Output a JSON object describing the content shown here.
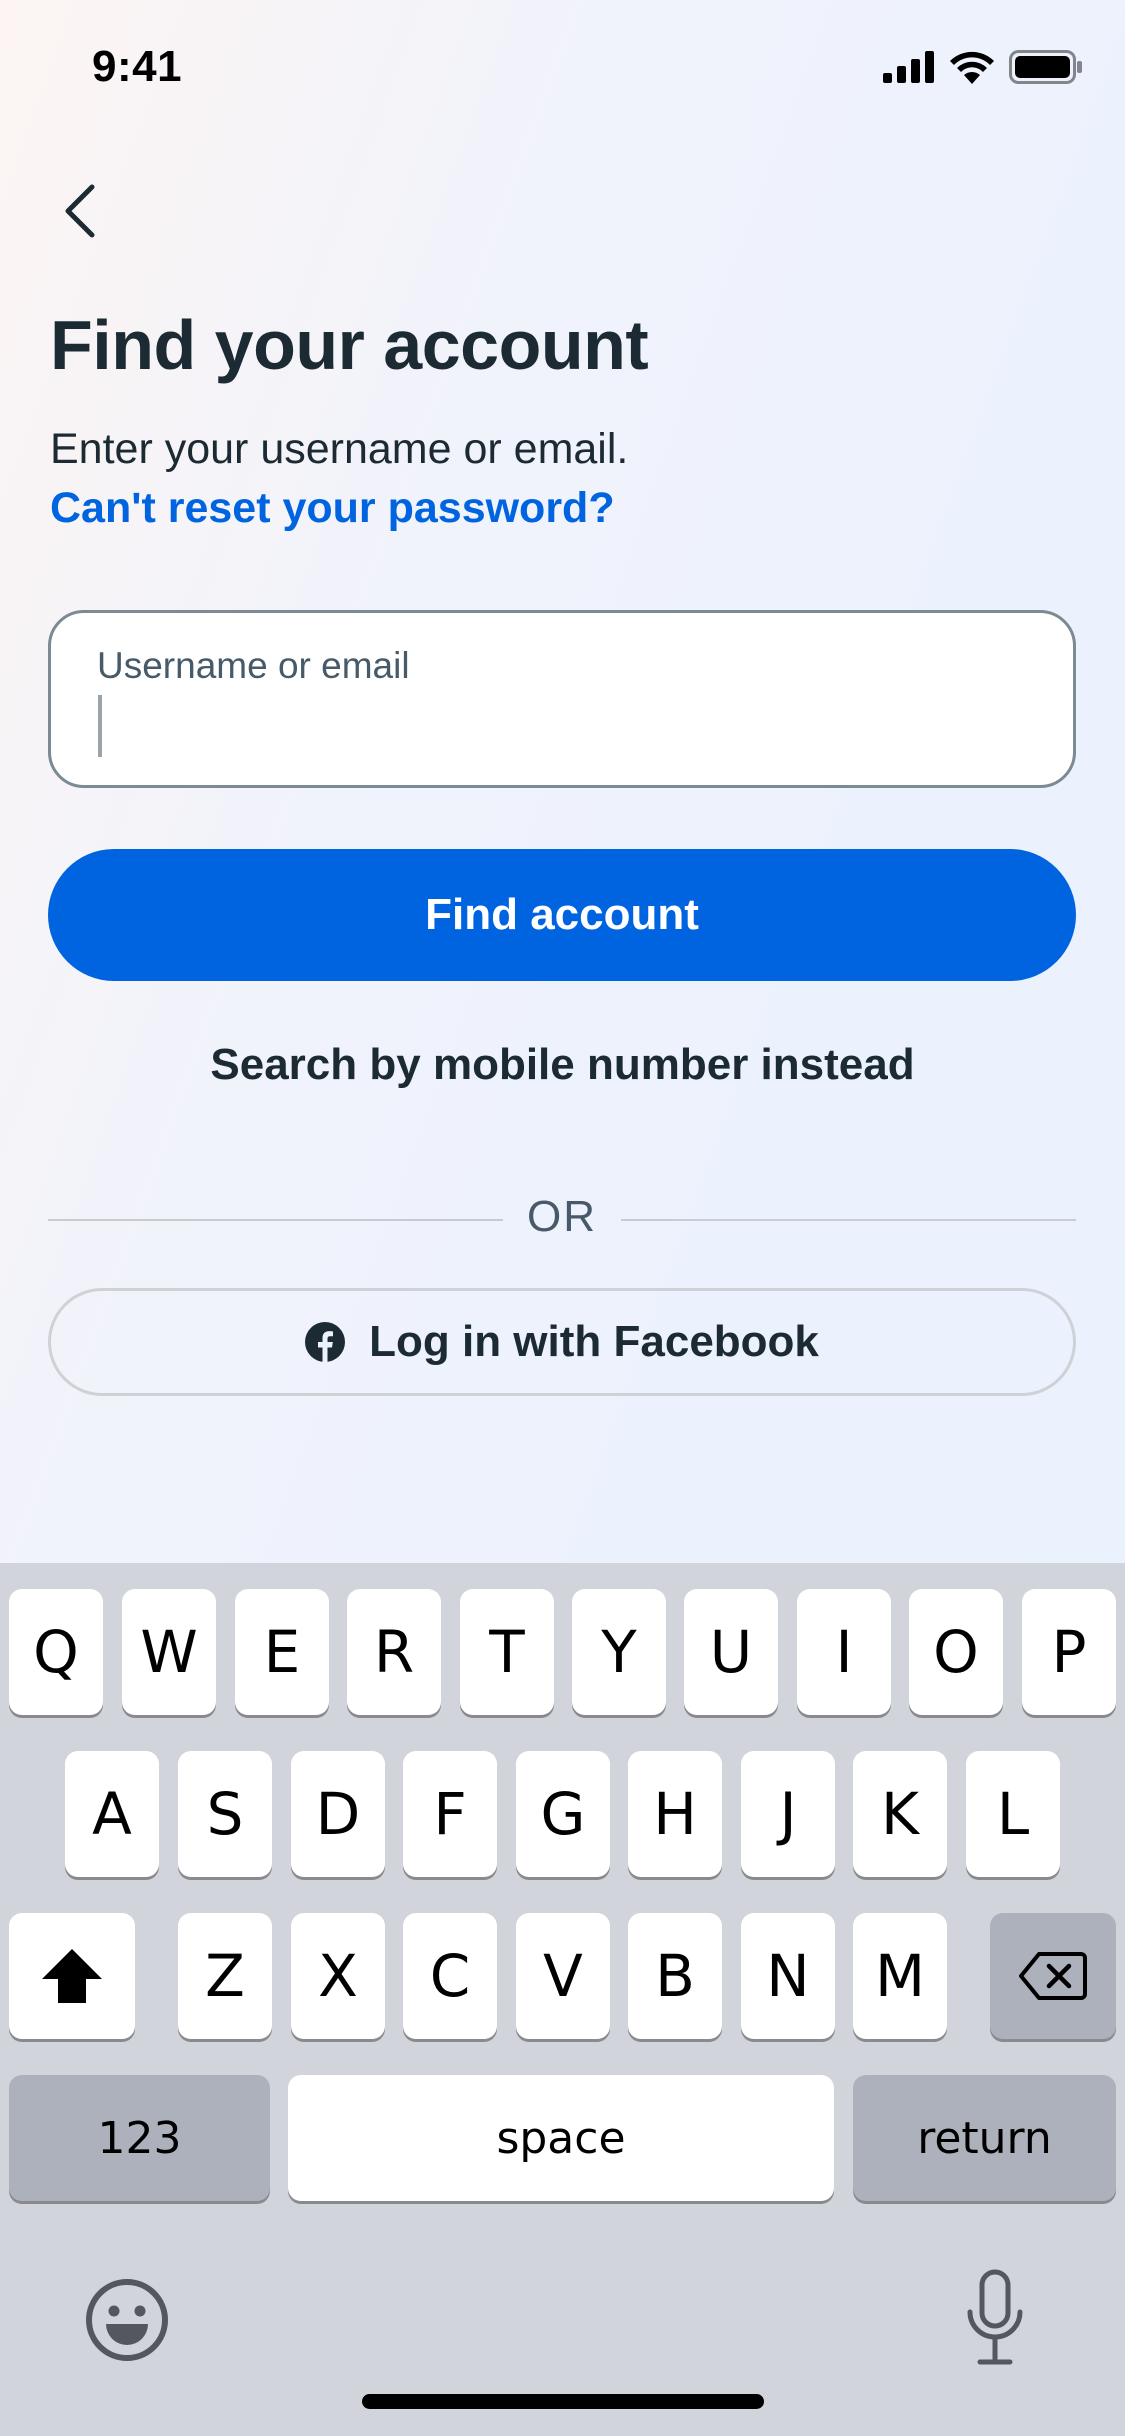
{
  "status_bar": {
    "time": "9:41"
  },
  "header": {
    "title": "Find your account",
    "subtitle": "Enter your username or email.",
    "reset_link": "Can't reset your password?"
  },
  "form": {
    "input_label": "Username or email",
    "input_value": "",
    "find_button": "Find account",
    "mobile_link": "Search by mobile number instead",
    "divider_text": "OR",
    "facebook_button": "Log in with Facebook"
  },
  "colors": {
    "primary": "#0064e0",
    "text": "#1c2b33",
    "keyboard_bg": "#d1d4db"
  },
  "keyboard": {
    "row1": [
      "Q",
      "W",
      "E",
      "R",
      "T",
      "Y",
      "U",
      "I",
      "O",
      "P"
    ],
    "row2": [
      "A",
      "S",
      "D",
      "F",
      "G",
      "H",
      "J",
      "K",
      "L"
    ],
    "row3": [
      "Z",
      "X",
      "C",
      "V",
      "B",
      "N",
      "M"
    ],
    "numbers_key": "123",
    "space_key": "space",
    "return_key": "return",
    "icons": [
      "shift-icon",
      "backspace-icon",
      "emoji-icon",
      "microphone-icon"
    ]
  }
}
